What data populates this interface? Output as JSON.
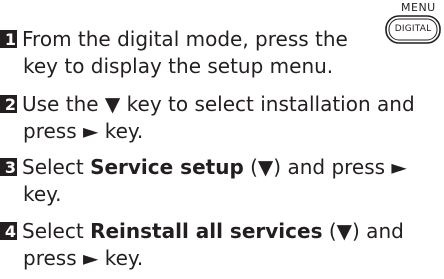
{
  "menu_key": {
    "top_label": "MENU",
    "button_label": "DIGITAL"
  },
  "steps": [
    {
      "number": "1",
      "text_a": "From the digital mode, press the",
      "text_b": "key to display the setup menu."
    },
    {
      "number": "2",
      "text_a": "Use the ▼ key to select installation and",
      "text_b": "press ► key."
    },
    {
      "number": "3",
      "text_a": "Select ",
      "bold": "Service setup",
      "text_c": " (▼) and press ►",
      "text_b": "key."
    },
    {
      "number": "4",
      "text_a": "Select ",
      "bold": "Reinstall all services",
      "text_c": " (▼) and",
      "text_b": "press ► key."
    }
  ]
}
